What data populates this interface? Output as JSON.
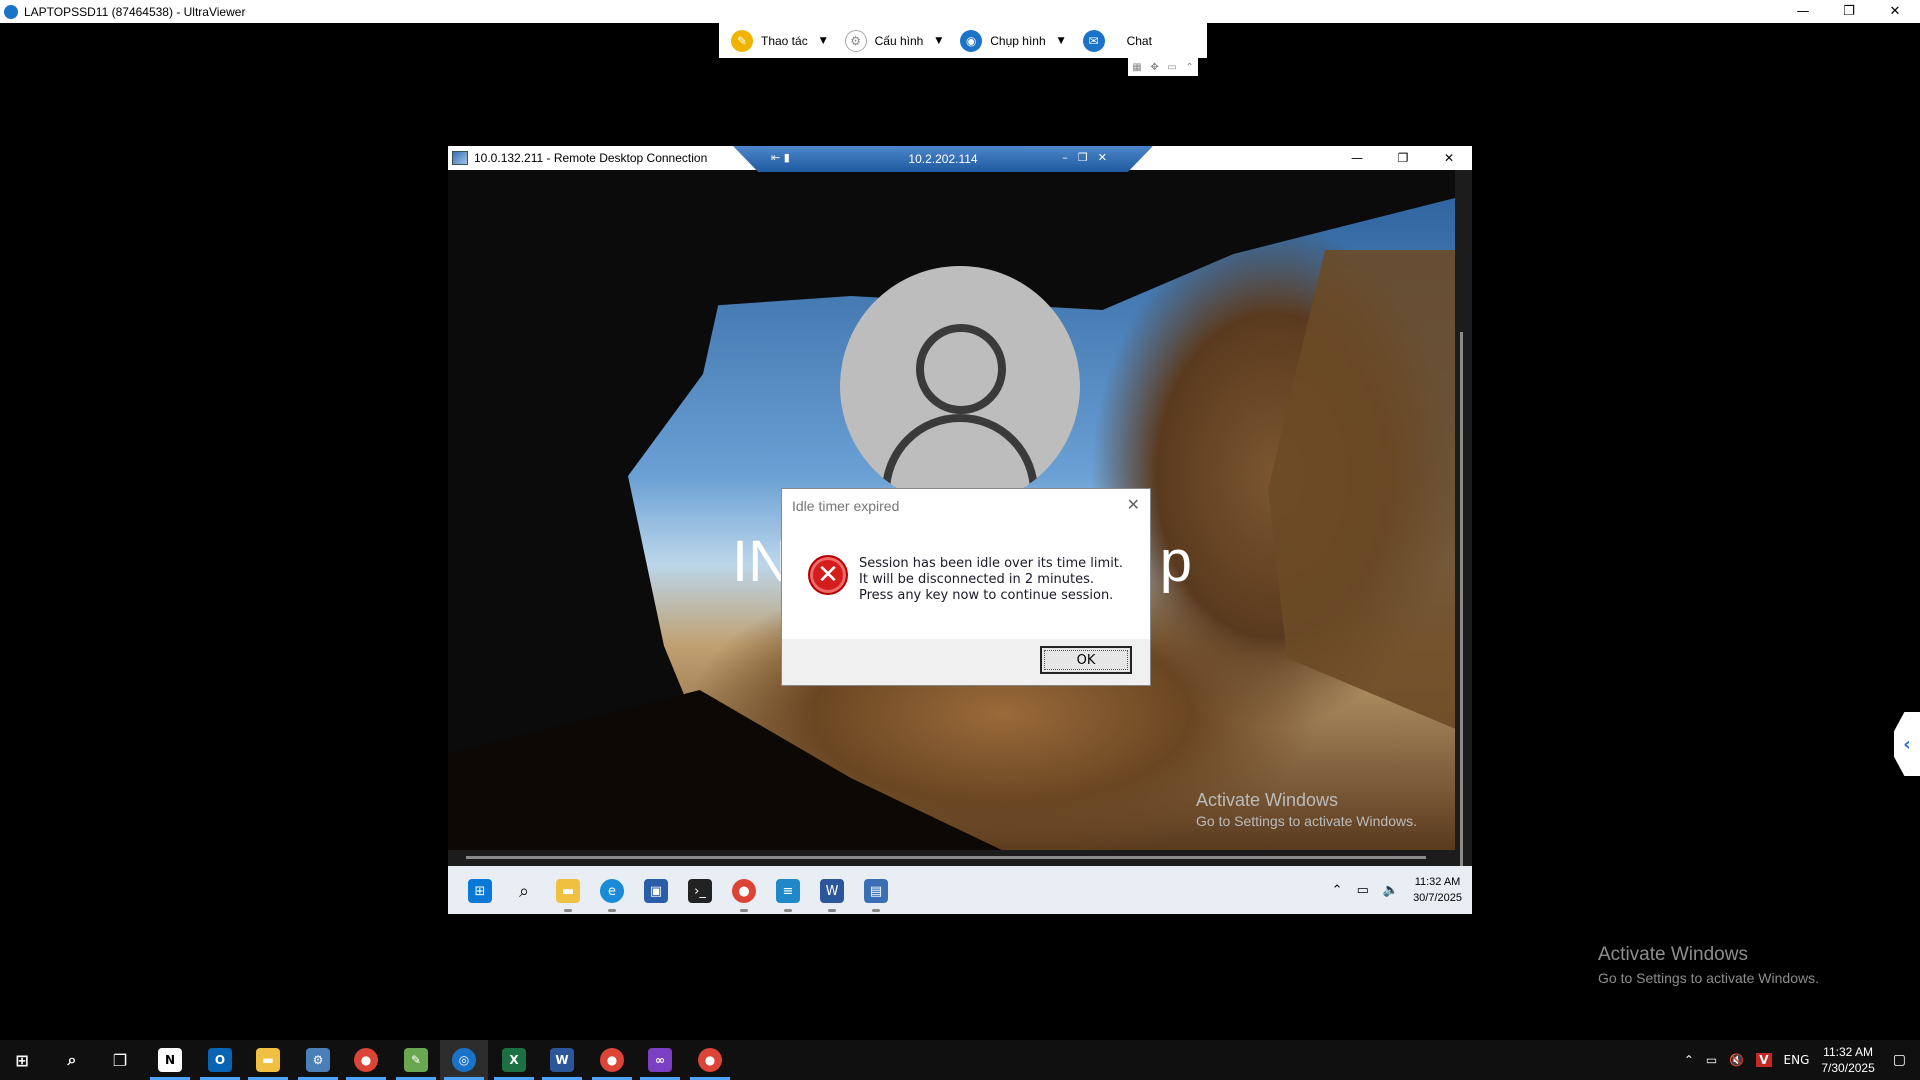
{
  "host_window": {
    "title": "LAPTOPSSD11 (87464538) - UltraViewer",
    "minimize": "—",
    "restore": "❐",
    "close": "✕"
  },
  "toolbar": {
    "actions_label": "Thao tác",
    "config_label": "Cấu hình",
    "screenshot_label": "Chụp hình",
    "chat_label": "Chat",
    "actions_icon": "pencil-icon",
    "config_icon": "gear-icon",
    "screenshot_icon": "camera-icon",
    "chat_icon": "chat-icon"
  },
  "rdc_window": {
    "title": "10.0.132.211 - Remote Desktop Connection",
    "connection_bar_ip": "10.2.202.114"
  },
  "remote_lock": {
    "user_name_left": "IN",
    "user_name_right": "p"
  },
  "idle_dialog": {
    "title": "Idle timer expired",
    "line1": "Session has been idle over its time limit.",
    "line2": "It will be disconnected in 2 minutes.",
    "line3": "Press any key now to continue session.",
    "ok_label": "OK"
  },
  "watermark": {
    "line1": "Activate Windows",
    "line2": "Go to Settings to activate Windows."
  },
  "remote_taskbar": {
    "time": "11:32 AM",
    "date": "30/7/2025"
  },
  "host_taskbar": {
    "time": "11:32 AM",
    "date": "7/30/2025",
    "language": "ENG"
  },
  "colors": {
    "accent": "#1a73c8",
    "error": "#d41e1e",
    "taskbar": "#101010"
  }
}
